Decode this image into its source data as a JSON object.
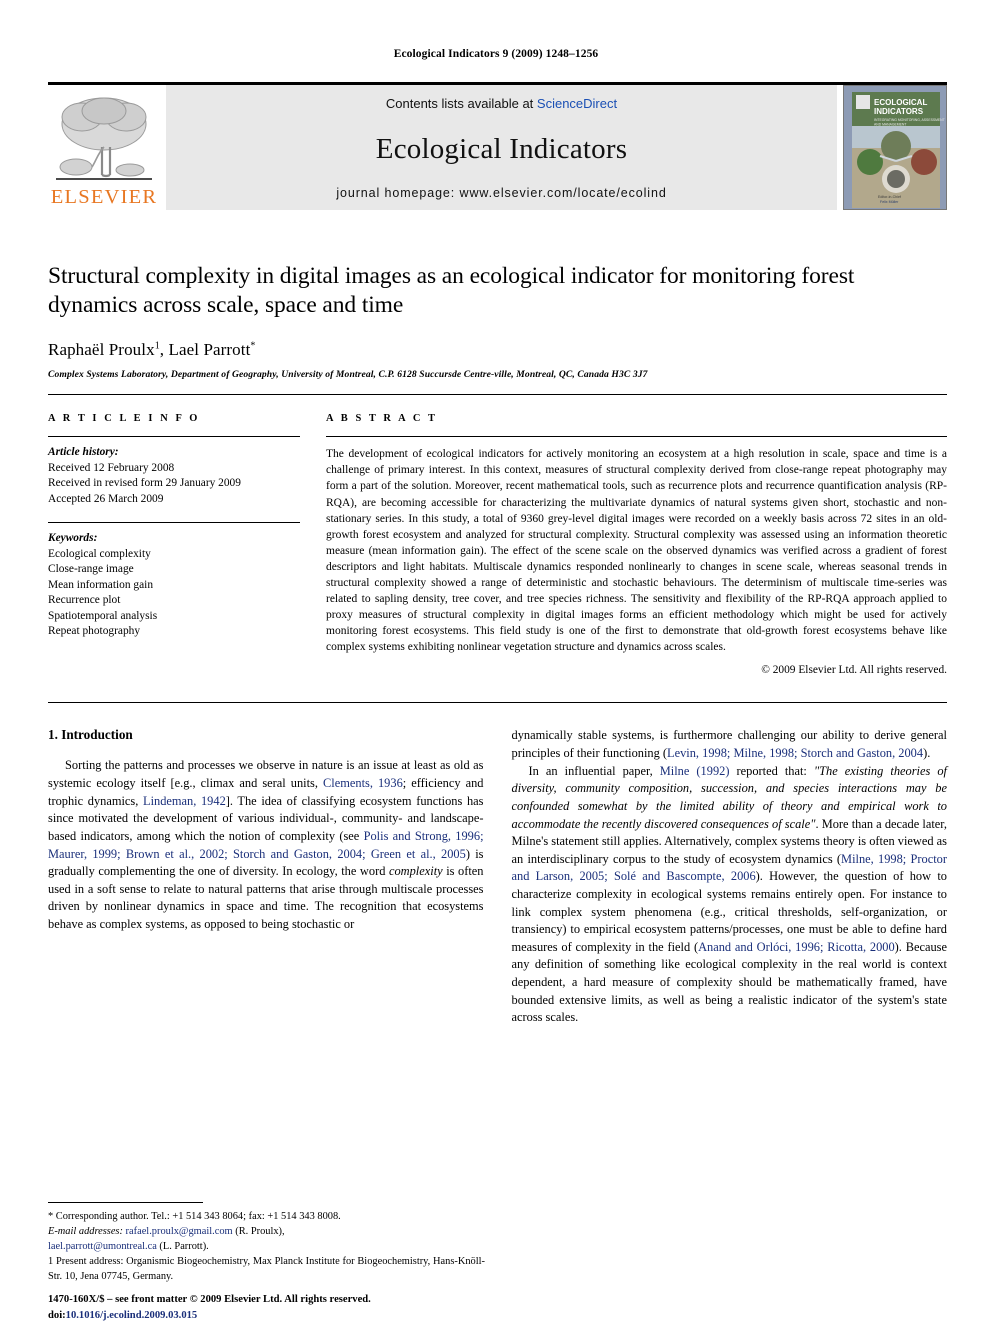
{
  "running_head": "Ecological Indicators 9 (2009) 1248–1256",
  "masthead": {
    "contents_prefix": "Contents lists available at ",
    "sciencedirect": "ScienceDirect",
    "journal_title": "Ecological Indicators",
    "homepage": "journal homepage: www.elsevier.com/locate/ecolind",
    "publisher_wordmark": "ELSEVIER",
    "cover_title_line1": "ECOLOGICAL",
    "cover_title_line2": "INDICATORS",
    "cover_subtitle": "INTEGRATING MONITORING, ASSESSMENT AND MANAGEMENT",
    "accent_orange": "#E87722",
    "link_blue": "#1a4fb4"
  },
  "title": "Structural complexity in digital images as an ecological indicator for monitoring forest dynamics across scale, space and time",
  "authors": {
    "a1_name": "Raphaël Proulx",
    "a1_sup": "1",
    "separator": ", ",
    "a2_name": "Lael Parrott",
    "a2_sup": "*"
  },
  "affiliation": "Complex Systems Laboratory, Department of Geography, University of Montreal, C.P. 6128 Succursde Centre-ville, Montreal, QC, Canada H3C 3J7",
  "article_info": {
    "heading": "A R T I C L E   I N F O",
    "history_label": "Article history:",
    "history": [
      "Received 12 February 2008",
      "Received in revised form 29 January 2009",
      "Accepted 26 March 2009"
    ],
    "keywords_label": "Keywords:",
    "keywords": [
      "Ecological complexity",
      "Close-range image",
      "Mean information gain",
      "Recurrence plot",
      "Spatiotemporal analysis",
      "Repeat photography"
    ]
  },
  "abstract": {
    "heading": "A B S T R A C T",
    "text": "The development of ecological indicators for actively monitoring an ecosystem at a high resolution in scale, space and time is a challenge of primary interest. In this context, measures of structural complexity derived from close-range repeat photography may form a part of the solution. Moreover, recent mathematical tools, such as recurrence plots and recurrence quantification analysis (RP-RQA), are becoming accessible for characterizing the multivariate dynamics of natural systems given short, stochastic and non-stationary series. In this study, a total of 9360 grey-level digital images were recorded on a weekly basis across 72 sites in an old-growth forest ecosystem and analyzed for structural complexity. Structural complexity was assessed using an information theoretic measure (mean information gain). The effect of the scene scale on the observed dynamics was verified across a gradient of forest descriptors and light habitats. Multiscale dynamics responded nonlinearly to changes in scene scale, whereas seasonal trends in structural complexity showed a range of deterministic and stochastic behaviours. The determinism of multiscale time-series was related to sapling density, tree cover, and tree species richness. The sensitivity and flexibility of the RP-RQA approach applied to proxy measures of structural complexity in digital images forms an efficient methodology which might be used for actively monitoring forest ecosystems. This field study is one of the first to demonstrate that old-growth forest ecosystems behave like complex systems exhibiting nonlinear vegetation structure and dynamics across scales.",
    "copyright": "© 2009 Elsevier Ltd. All rights reserved."
  },
  "introduction": {
    "heading": "1. Introduction",
    "left_paragraphs": [
      "Sorting the patterns and processes we observe in nature is an issue at least as old as systemic ecology itself [e.g., climax and seral units, |Clements, 1936|; efficiency and trophic dynamics, |Lindeman, 1942|]. The idea of classifying ecosystem functions has since motivated the development of various individual-, community- and landscape-based indicators, among which the notion of complexity (see |Polis and Strong, 1996; Maurer, 1999; Brown et al., 2002; Storch and Gaston, 2004; Green et al., 2005|) is gradually complementing the one of diversity. In ecology, the word //complexity// is often used in a soft sense to relate to natural patterns that arise through multiscale processes driven by nonlinear dynamics in space and time. The recognition that ecosystems behave as complex systems, as opposed to being stochastic or"
    ],
    "right_paragraphs": [
      "dynamically stable systems, is furthermore challenging our ability to derive general principles of their functioning (|Levin, 1998; Milne, 1998; Storch and Gaston, 2004|).",
      "In an influential paper, |Milne (1992)| reported that: //\"The existing theories of diversity, community composition, succession, and species interactions may be confounded somewhat by the limited ability of theory and empirical work to accommodate the recently discovered consequences of scale\"//. More than a decade later, Milne's statement still applies. Alternatively, complex systems theory is often viewed as an interdisciplinary corpus to the study of ecosystem dynamics (|Milne, 1998; Proctor and Larson, 2005; Solé and Bascompte, 2006|). However, the question of how to characterize complexity in ecological systems remains entirely open. For instance to link complex system phenomena (e.g., critical thresholds, self-organization, or transiency) to empirical ecosystem patterns/processes, one must be able to define hard measures of complexity in the field (|Anand and Orlóci, 1996; Ricotta, 2000|). Because any definition of something like ecological complexity in the real world is context dependent, a hard measure of complexity should be mathematically framed, have bounded extensive limits, as well as being a realistic indicator of the system's state across scales."
    ]
  },
  "footnotes": {
    "corresponding": "* Corresponding author. Tel.: +1 514 343 8064; fax: +1 514 343 8008.",
    "email_label": "E-mail addresses:",
    "email1": "rafael.proulx@gmail.com",
    "email1_who": " (R. Proulx),",
    "email2": "lael.parrott@umontreal.ca",
    "email2_who": " (L. Parrott).",
    "present_address": "1 Present address: Organismic Biogeochemistry, Max Planck Institute for Biogeochemistry, Hans-Knöll-Str. 10, Jena 07745, Germany.",
    "issn_line": "1470-160X/$ – see front matter © 2009 Elsevier Ltd. All rights reserved.",
    "doi_label": "doi:",
    "doi_value": "10.1016/j.ecolind.2009.03.015"
  }
}
